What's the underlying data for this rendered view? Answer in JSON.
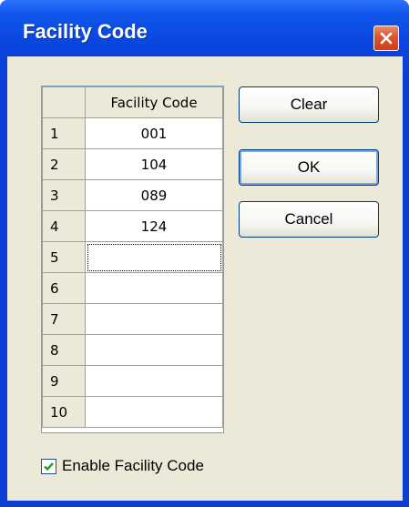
{
  "window": {
    "title": "Facility Code",
    "close_icon": "close-icon"
  },
  "grid": {
    "column_header": "Facility Code",
    "rows": [
      {
        "num": "1",
        "value": "001"
      },
      {
        "num": "2",
        "value": "104"
      },
      {
        "num": "3",
        "value": "089"
      },
      {
        "num": "4",
        "value": "124"
      },
      {
        "num": "5",
        "value": ""
      },
      {
        "num": "6",
        "value": ""
      },
      {
        "num": "7",
        "value": ""
      },
      {
        "num": "8",
        "value": ""
      },
      {
        "num": "9",
        "value": ""
      },
      {
        "num": "10",
        "value": ""
      }
    ],
    "focused_row": "5"
  },
  "buttons": {
    "clear": "Clear",
    "ok": "OK",
    "cancel": "Cancel"
  },
  "options": {
    "enable_label": "Enable Facility Code",
    "enable_checked": true
  },
  "colors": {
    "titlebar": "#0a46df",
    "dialog_bg": "#ece9d8",
    "close_button": "#d8552f",
    "checkmark": "#21a121"
  }
}
